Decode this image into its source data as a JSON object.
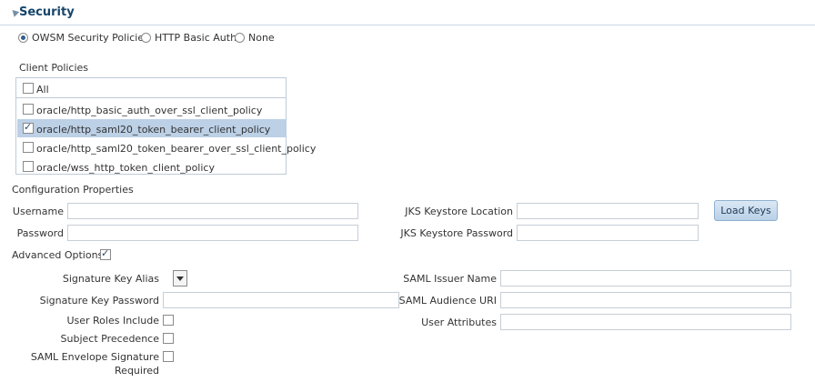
{
  "section": {
    "title": "Security"
  },
  "auth_options": {
    "options": [
      "OWSM Security Policies",
      "HTTP Basic Auth",
      "None"
    ],
    "selected": "OWSM Security Policies"
  },
  "client_policies": {
    "label": "Client Policies",
    "all_label": "All",
    "items": [
      {
        "label": "oracle/http_basic_auth_over_ssl_client_policy",
        "checked": false
      },
      {
        "label": "oracle/http_saml20_token_bearer_client_policy",
        "checked": true
      },
      {
        "label": "oracle/http_saml20_token_bearer_over_ssl_client_policy",
        "checked": false
      },
      {
        "label": "oracle/wss_http_token_client_policy",
        "checked": false
      }
    ]
  },
  "config": {
    "title": "Configuration Properties",
    "username_label": "Username",
    "username_value": "",
    "password_label": "Password",
    "password_value": "",
    "jks_location_label": "JKS Keystore Location",
    "jks_location_value": "",
    "jks_password_label": "JKS Keystore Password",
    "jks_password_value": "",
    "load_keys_label": "Load Keys"
  },
  "advanced": {
    "label": "Advanced Options",
    "checked": true,
    "signature_key_alias_label": "Signature Key Alias",
    "signature_key_password_label": "Signature Key Password",
    "user_roles_include_label": "User Roles Include",
    "subject_precedence_label": "Subject Precedence",
    "saml_envelope_signature_label_line1": "SAML Envelope Signature",
    "saml_envelope_signature_label_line2": "Required",
    "saml_issuer_name_label": "SAML Issuer Name",
    "saml_audience_uri_label": "SAML Audience URI",
    "user_attributes_label": "User Attributes"
  },
  "colors": {
    "section_title": "#17456b",
    "selected_row": "#bcd0e6",
    "button_border": "#8fb0cf"
  }
}
